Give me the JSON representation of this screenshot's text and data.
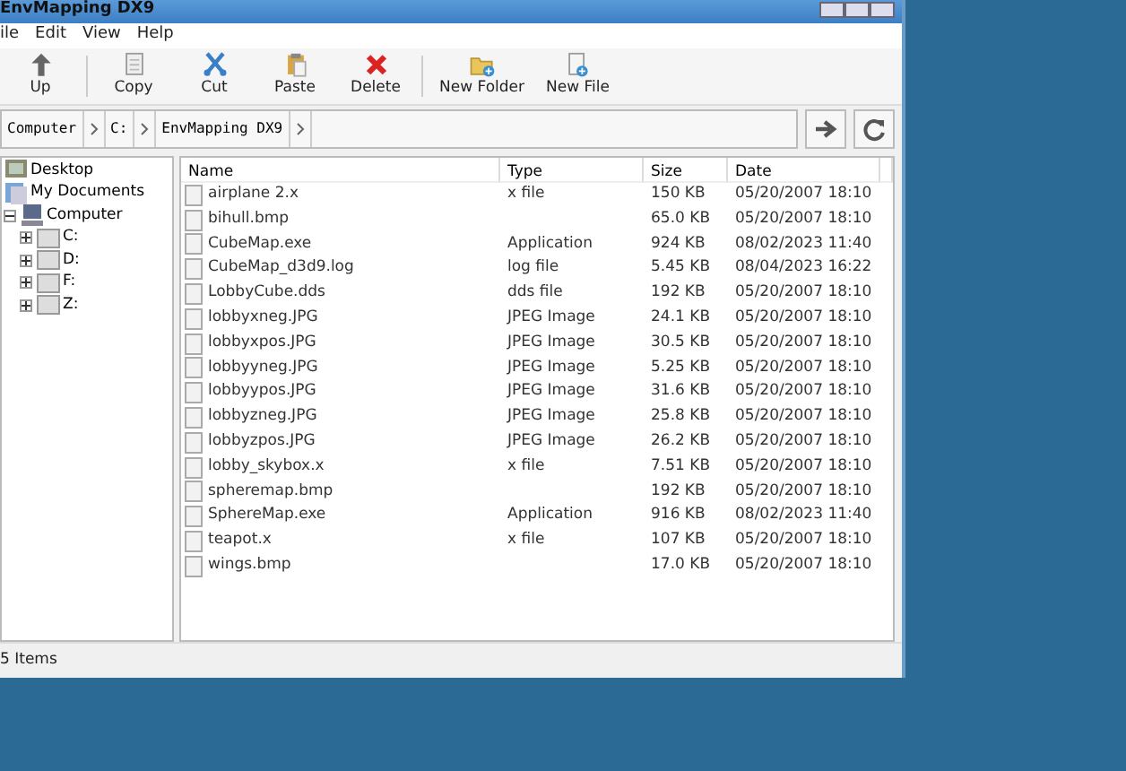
{
  "window": {
    "title": "EnvMapping DX9"
  },
  "menu": [
    "ile",
    "Edit",
    "View",
    "Help"
  ],
  "toolbar": [
    [
      {
        "label": "Up",
        "kind": "up"
      }
    ],
    [
      {
        "label": "Copy",
        "kind": "copy"
      },
      {
        "label": "Cut",
        "kind": "cut"
      },
      {
        "label": "Paste",
        "kind": "paste"
      },
      {
        "label": "Delete",
        "kind": "delete"
      }
    ],
    [
      {
        "label": "New Folder",
        "kind": "newfolder"
      },
      {
        "label": "New File",
        "kind": "newfile"
      }
    ]
  ],
  "address": {
    "crumbs": [
      "Computer",
      "C:",
      "EnvMapping DX9"
    ]
  },
  "tree": [
    {
      "label": "Desktop",
      "kind": "desktop"
    },
    {
      "label": "My Documents",
      "kind": "documents"
    },
    {
      "label": "Computer",
      "kind": "computer",
      "expanded": true,
      "children": [
        {
          "label": "C:",
          "kind": "drive",
          "expanded": false
        },
        {
          "label": "D:",
          "kind": "drive",
          "expanded": false
        },
        {
          "label": "F:",
          "kind": "drive",
          "expanded": false
        },
        {
          "label": "Z:",
          "kind": "drive",
          "expanded": false
        }
      ]
    }
  ],
  "table": {
    "columns": [
      "Name",
      "Type",
      "Size",
      "Date"
    ],
    "rows": [
      {
        "name": "airplane 2.x",
        "type": "x file",
        "size": "150 KB",
        "date": "05/20/2007 18:10"
      },
      {
        "name": "bihull.bmp",
        "size": "65.0 KB",
        "date": "05/20/2007 18:10"
      },
      {
        "name": "CubeMap.exe",
        "type": "Application",
        "size": "924 KB",
        "date": "08/02/2023 11:40"
      },
      {
        "name": "CubeMap_d3d9.log",
        "type": "log file",
        "size": "5.45 KB",
        "date": "08/04/2023 16:22"
      },
      {
        "name": "LobbyCube.dds",
        "type": "dds file",
        "size": "192 KB",
        "date": "05/20/2007 18:10"
      },
      {
        "name": "lobbyxneg.JPG",
        "type": "JPEG Image",
        "size": "24.1 KB",
        "date": "05/20/2007 18:10"
      },
      {
        "name": "lobbyxpos.JPG",
        "type": "JPEG Image",
        "size": "30.5 KB",
        "date": "05/20/2007 18:10"
      },
      {
        "name": "lobbyyneg.JPG",
        "type": "JPEG Image",
        "size": "5.25 KB",
        "date": "05/20/2007 18:10"
      },
      {
        "name": "lobbyypos.JPG",
        "type": "JPEG Image",
        "size": "31.6 KB",
        "date": "05/20/2007 18:10"
      },
      {
        "name": "lobbyzneg.JPG",
        "type": "JPEG Image",
        "size": "25.8 KB",
        "date": "05/20/2007 18:10"
      },
      {
        "name": "lobbyzpos.JPG",
        "type": "JPEG Image",
        "size": "26.2 KB",
        "date": "05/20/2007 18:10"
      },
      {
        "name": "lobby_skybox.x",
        "type": "x file",
        "size": "7.51 KB",
        "date": "05/20/2007 18:10"
      },
      {
        "name": "spheremap.bmp",
        "size": "192 KB",
        "date": "05/20/2007 18:10"
      },
      {
        "name": "SphereMap.exe",
        "type": "Application",
        "size": "916 KB",
        "date": "08/02/2023 11:40"
      },
      {
        "name": "teapot.x",
        "type": "x file",
        "size": "107 KB",
        "date": "05/20/2007 18:10"
      },
      {
        "name": "wings.bmp",
        "size": "17.0 KB",
        "date": "05/20/2007 18:10"
      }
    ]
  },
  "status_bar": "5 Items"
}
